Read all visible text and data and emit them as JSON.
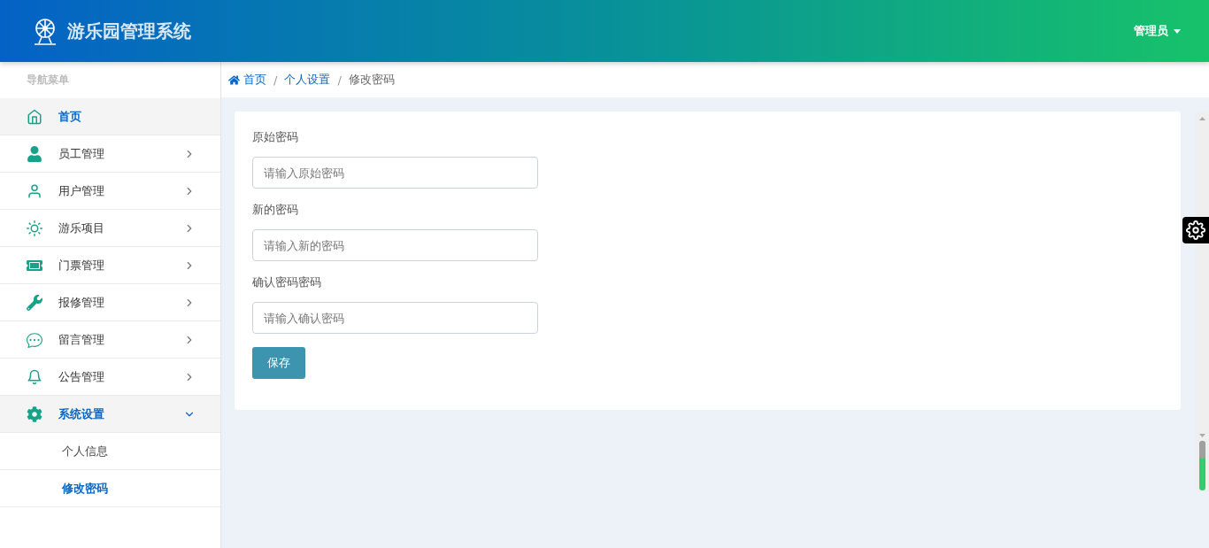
{
  "header": {
    "title": "游乐园管理系统",
    "user": "管理员"
  },
  "sidebar": {
    "heading": "导航菜单",
    "items": [
      {
        "label": "首页",
        "kind": "link",
        "selected": true
      },
      {
        "label": "员工管理",
        "kind": "submenu",
        "selected": false,
        "expanded": false
      },
      {
        "label": "用户管理",
        "kind": "submenu",
        "selected": false,
        "expanded": false
      },
      {
        "label": "游乐项目",
        "kind": "submenu",
        "selected": false,
        "expanded": false
      },
      {
        "label": "门票管理",
        "kind": "submenu",
        "selected": false,
        "expanded": false
      },
      {
        "label": "报修管理",
        "kind": "submenu",
        "selected": false,
        "expanded": false
      },
      {
        "label": "留言管理",
        "kind": "submenu",
        "selected": false,
        "expanded": false
      },
      {
        "label": "公告管理",
        "kind": "submenu",
        "selected": false,
        "expanded": false
      },
      {
        "label": "系统设置",
        "kind": "submenu",
        "selected": true,
        "expanded": true,
        "children": [
          {
            "label": "个人信息",
            "selected": false
          },
          {
            "label": "修改密码",
            "selected": true
          }
        ]
      }
    ]
  },
  "breadcrumb": {
    "separator": "/",
    "items": [
      {
        "label": "首页",
        "kind": "link"
      },
      {
        "label": "个人设置",
        "kind": "link"
      },
      {
        "label": "修改密码",
        "kind": "current"
      }
    ]
  },
  "form": {
    "fields": [
      {
        "label": "原始密码",
        "placeholder": "请输入原始密码"
      },
      {
        "label": "新的密码",
        "placeholder": "请输入新的密码"
      },
      {
        "label": "确认密码密码",
        "placeholder": "请输入确认密码"
      }
    ],
    "button": "保存"
  }
}
